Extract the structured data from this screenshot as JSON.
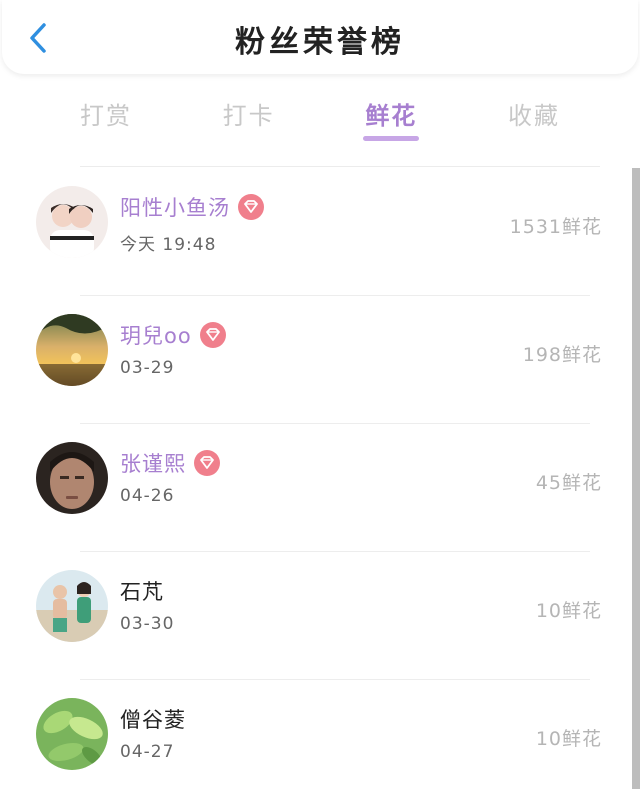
{
  "header": {
    "title": "粉丝荣誉榜",
    "back_icon": "chevron-left-icon"
  },
  "tabs": [
    {
      "label": "打赏",
      "active": false
    },
    {
      "label": "打卡",
      "active": false
    },
    {
      "label": "鲜花",
      "active": true
    },
    {
      "label": "收藏",
      "active": false
    }
  ],
  "fans": [
    {
      "name": "阳性小鱼汤",
      "time": "今天 19:48",
      "amount": "1531鲜花",
      "vip": true
    },
    {
      "name": "玥兒oo",
      "time": "03-29",
      "amount": "198鲜花",
      "vip": true
    },
    {
      "name": "张谨熙",
      "time": "04-26",
      "amount": "45鲜花",
      "vip": true
    },
    {
      "name": "石芃",
      "time": "03-30",
      "amount": "10鲜花",
      "vip": false
    },
    {
      "name": "僧谷菱",
      "time": "04-27",
      "amount": "10鲜花",
      "vip": false
    }
  ],
  "colors": {
    "accent": "#a77fd0",
    "tab_underline": "#c7a6e6",
    "badge": "#f07f8c",
    "back_icon": "#2f8fe0"
  }
}
